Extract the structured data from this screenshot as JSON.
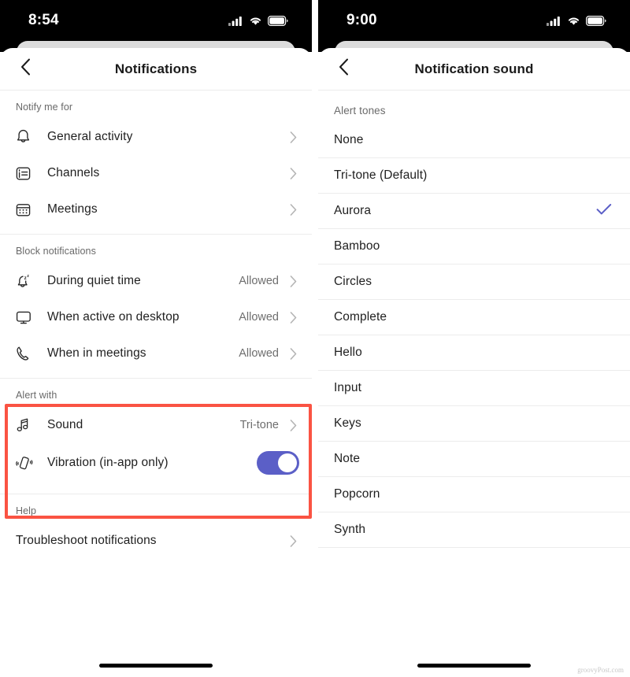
{
  "left_phone": {
    "status_bar": {
      "time": "8:54",
      "icons": [
        "cellular-signal-icon",
        "wifi-icon",
        "battery-icon"
      ]
    },
    "nav": {
      "back_icon": "chevron-left-icon",
      "title": "Notifications"
    },
    "sections": [
      {
        "header": "Notify me for",
        "rows": [
          {
            "icon": "bell-icon",
            "label": "General activity",
            "value": "",
            "accessory": "chevron-right-icon"
          },
          {
            "icon": "channels-icon",
            "label": "Channels",
            "value": "",
            "accessory": "chevron-right-icon"
          },
          {
            "icon": "calendar-icon",
            "label": "Meetings",
            "value": "",
            "accessory": "chevron-right-icon"
          }
        ]
      },
      {
        "header": "Block notifications",
        "rows": [
          {
            "icon": "bell-sleep-icon",
            "label": "During quiet time",
            "value": "Allowed",
            "accessory": "chevron-right-icon"
          },
          {
            "icon": "monitor-icon",
            "label": "When active on desktop",
            "value": "Allowed",
            "accessory": "chevron-right-icon"
          },
          {
            "icon": "phone-call-icon",
            "label": "When in meetings",
            "value": "Allowed",
            "accessory": "chevron-right-icon"
          }
        ]
      },
      {
        "header": "Alert with",
        "highlighted": true,
        "rows": [
          {
            "icon": "music-note-icon",
            "label": "Sound",
            "value": "Tri-tone",
            "accessory": "chevron-right-icon"
          },
          {
            "icon": "vibration-icon",
            "label": "Vibration (in-app only)",
            "value": "",
            "accessory": "toggle",
            "toggle_on": true
          }
        ]
      },
      {
        "header": "Help",
        "rows": [
          {
            "icon": "",
            "label": "Troubleshoot notifications",
            "value": "",
            "accessory": "chevron-right-icon"
          }
        ]
      }
    ]
  },
  "right_phone": {
    "status_bar": {
      "time": "9:00",
      "icons": [
        "cellular-signal-icon",
        "wifi-icon",
        "battery-icon"
      ]
    },
    "nav": {
      "back_icon": "chevron-left-icon",
      "title": "Notification sound"
    },
    "section_header": "Alert tones",
    "tones": [
      {
        "label": "None",
        "selected": false
      },
      {
        "label": "Tri-tone (Default)",
        "selected": false
      },
      {
        "label": "Aurora",
        "selected": true
      },
      {
        "label": "Bamboo",
        "selected": false
      },
      {
        "label": "Circles",
        "selected": false
      },
      {
        "label": "Complete",
        "selected": false
      },
      {
        "label": "Hello",
        "selected": false
      },
      {
        "label": "Input",
        "selected": false
      },
      {
        "label": "Keys",
        "selected": false
      },
      {
        "label": "Note",
        "selected": false
      },
      {
        "label": "Popcorn",
        "selected": false
      },
      {
        "label": "Synth",
        "selected": false
      }
    ]
  },
  "watermark": "groovyPost.com",
  "colors": {
    "accent_purple": "#5B5FC7",
    "highlight_red": "#FA5343",
    "status_bar_bg": "#000000",
    "secondary_text": "#6E6E6E",
    "primary_text": "#1F1F1F"
  }
}
